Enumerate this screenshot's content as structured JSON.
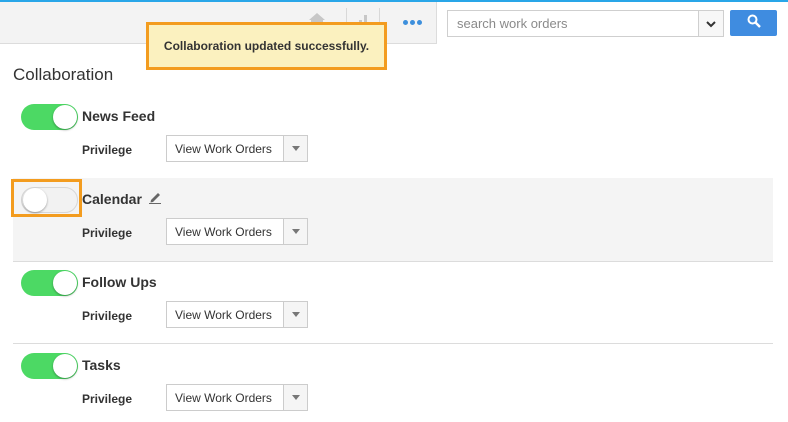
{
  "colors": {
    "accent": "#29a6e8",
    "search_button": "#3f8ce0",
    "toggle_on": "#4cd964",
    "highlight_border": "#f39c1f",
    "toast_background": "#fbf1bf"
  },
  "toolbar": {
    "icons": [
      "home-icon",
      "chart-icon",
      "more-icon",
      "chevron-down-icon",
      "search-icon"
    ]
  },
  "search": {
    "placeholder": "search work orders",
    "value": ""
  },
  "toast": {
    "message": "Collaboration updated successfully."
  },
  "page": {
    "title": "Collaboration"
  },
  "sections": [
    {
      "name": "News Feed",
      "enabled": true,
      "privilege_label": "Privilege",
      "privilege_value": "View Work Orders"
    },
    {
      "name": "Calendar",
      "enabled": false,
      "editable": true,
      "privilege_label": "Privilege",
      "privilege_value": "View Work Orders"
    },
    {
      "name": "Follow Ups",
      "enabled": true,
      "privilege_label": "Privilege",
      "privilege_value": "View Work Orders"
    },
    {
      "name": "Tasks",
      "enabled": true,
      "privilege_label": "Privilege",
      "privilege_value": "View Work Orders"
    }
  ]
}
